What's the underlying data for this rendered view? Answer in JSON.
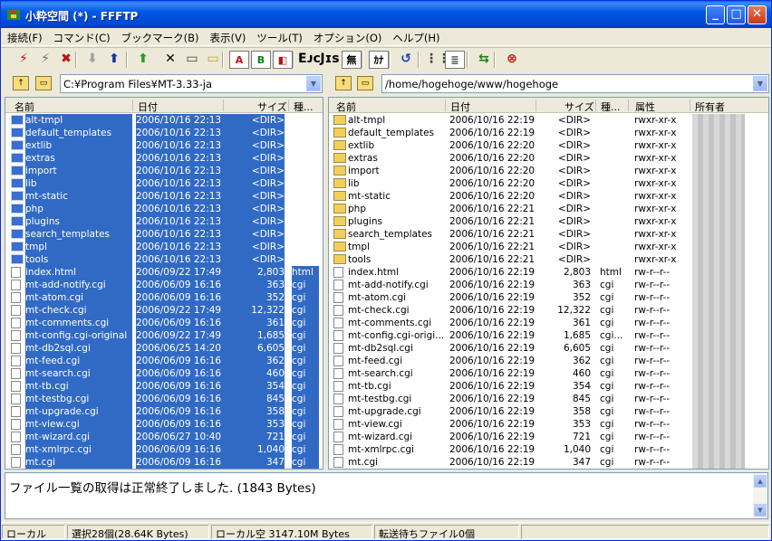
{
  "window": {
    "title": "小粋空間 (*) - FFFTP",
    "controls": {
      "minimize": "_",
      "maximize": "□",
      "close": "✕"
    }
  },
  "menu": [
    {
      "label": "接続(F)"
    },
    {
      "label": "コマンド(C)"
    },
    {
      "label": "ブックマーク(B)"
    },
    {
      "label": "表示(V)"
    },
    {
      "label": "ツール(T)"
    },
    {
      "label": "オプション(O)"
    },
    {
      "label": "ヘルプ(H)"
    }
  ],
  "toolbar": [
    {
      "name": "connect-icon",
      "glyph": "⚡",
      "color": "#d01010"
    },
    {
      "name": "quick-connect-icon",
      "glyph": "⚡",
      "color": "#707070"
    },
    {
      "name": "disconnect-icon",
      "glyph": "✖",
      "color": "#c01010"
    },
    {
      "name": "download-icon",
      "glyph": "⬇",
      "color": "#a0a0a0"
    },
    {
      "name": "upload-icon",
      "glyph": "⬆",
      "color": "#1030b0"
    },
    {
      "name": "mirror-upload-icon",
      "glyph": "⬆",
      "color": "#20a020"
    },
    {
      "name": "delete-icon",
      "glyph": "✕",
      "color": "#000000"
    },
    {
      "name": "rename-icon",
      "glyph": "▭",
      "color": "#404040"
    },
    {
      "name": "mkdir-icon",
      "glyph": "▭",
      "color": "#c8a020"
    },
    {
      "name": "ascii-mode-icon",
      "glyph": "A",
      "color": "#c01010",
      "boxed": true
    },
    {
      "name": "binary-mode-icon",
      "glyph": "B",
      "color": "#108010",
      "boxed": true
    },
    {
      "name": "auto-mode-icon",
      "glyph": "◧",
      "color": "#c01010",
      "boxed": true
    },
    {
      "name": "kanji-euc-icon",
      "glyph": "Eᴊᴄ",
      "color": "#000000"
    },
    {
      "name": "kanji-jis-icon",
      "glyph": "Jɪs",
      "color": "#000000"
    },
    {
      "name": "kanji-none-icon",
      "glyph": "無",
      "color": "#000000",
      "boxed": true
    },
    {
      "name": "kana-convert-icon",
      "glyph": "ｶﾅ",
      "color": "#000000",
      "boxed": true
    },
    {
      "name": "refresh-icon",
      "glyph": "↺",
      "color": "#1040c0"
    },
    {
      "name": "list-view-icon",
      "glyph": "⋮⋮",
      "color": "#404040"
    },
    {
      "name": "detail-view-icon",
      "glyph": "≣",
      "color": "#404040",
      "boxed": true
    },
    {
      "name": "sync-dir-icon",
      "glyph": "⇆",
      "color": "#208020"
    },
    {
      "name": "abort-icon",
      "glyph": "⊗",
      "color": "#d01010"
    }
  ],
  "local": {
    "path": "C:¥Program Files¥MT-3.33-ja",
    "headers": {
      "name": "名前",
      "date": "日付",
      "size": "サイズ",
      "type": "種..."
    },
    "rows": [
      {
        "n": "alt-tmpl",
        "d": "2006/10/16 22:13",
        "s": "<DIR>",
        "t": "",
        "dir": true
      },
      {
        "n": "default_templates",
        "d": "2006/10/16 22:13",
        "s": "<DIR>",
        "t": "",
        "dir": true
      },
      {
        "n": "extlib",
        "d": "2006/10/16 22:13",
        "s": "<DIR>",
        "t": "",
        "dir": true
      },
      {
        "n": "extras",
        "d": "2006/10/16 22:13",
        "s": "<DIR>",
        "t": "",
        "dir": true
      },
      {
        "n": "import",
        "d": "2006/10/16 22:13",
        "s": "<DIR>",
        "t": "",
        "dir": true
      },
      {
        "n": "lib",
        "d": "2006/10/16 22:13",
        "s": "<DIR>",
        "t": "",
        "dir": true
      },
      {
        "n": "mt-static",
        "d": "2006/10/16 22:13",
        "s": "<DIR>",
        "t": "",
        "dir": true
      },
      {
        "n": "php",
        "d": "2006/10/16 22:13",
        "s": "<DIR>",
        "t": "",
        "dir": true
      },
      {
        "n": "plugins",
        "d": "2006/10/16 22:13",
        "s": "<DIR>",
        "t": "",
        "dir": true
      },
      {
        "n": "search_templates",
        "d": "2006/10/16 22:13",
        "s": "<DIR>",
        "t": "",
        "dir": true
      },
      {
        "n": "tmpl",
        "d": "2006/10/16 22:13",
        "s": "<DIR>",
        "t": "",
        "dir": true
      },
      {
        "n": "tools",
        "d": "2006/10/16 22:13",
        "s": "<DIR>",
        "t": "",
        "dir": true
      },
      {
        "n": "index.html",
        "d": "2006/09/22 17:49",
        "s": "2,803",
        "t": "html",
        "dir": false
      },
      {
        "n": "mt-add-notify.cgi",
        "d": "2006/06/09 16:16",
        "s": "363",
        "t": "cgi",
        "dir": false
      },
      {
        "n": "mt-atom.cgi",
        "d": "2006/06/09 16:16",
        "s": "352",
        "t": "cgi",
        "dir": false
      },
      {
        "n": "mt-check.cgi",
        "d": "2006/09/22 17:49",
        "s": "12,322",
        "t": "cgi",
        "dir": false
      },
      {
        "n": "mt-comments.cgi",
        "d": "2006/06/09 16:16",
        "s": "361",
        "t": "cgi",
        "dir": false
      },
      {
        "n": "mt-config.cgi-original",
        "d": "2006/09/22 17:49",
        "s": "1,685",
        "t": "cgi",
        "dir": false
      },
      {
        "n": "mt-db2sql.cgi",
        "d": "2006/06/25 14:20",
        "s": "6,605",
        "t": "cgi",
        "dir": false
      },
      {
        "n": "mt-feed.cgi",
        "d": "2006/06/09 16:16",
        "s": "362",
        "t": "cgi",
        "dir": false
      },
      {
        "n": "mt-search.cgi",
        "d": "2006/06/09 16:16",
        "s": "460",
        "t": "cgi",
        "dir": false
      },
      {
        "n": "mt-tb.cgi",
        "d": "2006/06/09 16:16",
        "s": "354",
        "t": "cgi",
        "dir": false
      },
      {
        "n": "mt-testbg.cgi",
        "d": "2006/06/09 16:16",
        "s": "845",
        "t": "cgi",
        "dir": false
      },
      {
        "n": "mt-upgrade.cgi",
        "d": "2006/06/09 16:16",
        "s": "358",
        "t": "cgi",
        "dir": false
      },
      {
        "n": "mt-view.cgi",
        "d": "2006/06/09 16:16",
        "s": "353",
        "t": "cgi",
        "dir": false
      },
      {
        "n": "mt-wizard.cgi",
        "d": "2006/06/27 10:40",
        "s": "721",
        "t": "cgi",
        "dir": false
      },
      {
        "n": "mt-xmlrpc.cgi",
        "d": "2006/06/09 16:16",
        "s": "1,040",
        "t": "cgi",
        "dir": false
      },
      {
        "n": "mt.cgi",
        "d": "2006/06/09 16:16",
        "s": "347",
        "t": "cgi",
        "dir": false
      }
    ]
  },
  "remote": {
    "path": "/home/hogehoge/www/hogehoge",
    "headers": {
      "name": "名前",
      "date": "日付",
      "size": "サイズ",
      "type": "種...",
      "attr": "属性",
      "owner": "所有者"
    },
    "rows": [
      {
        "n": "alt-tmpl",
        "d": "2006/10/16 22:19",
        "s": "<DIR>",
        "t": "",
        "a": "rwxr-xr-x",
        "dir": true
      },
      {
        "n": "default_templates",
        "d": "2006/10/16 22:19",
        "s": "<DIR>",
        "t": "",
        "a": "rwxr-xr-x",
        "dir": true
      },
      {
        "n": "extlib",
        "d": "2006/10/16 22:20",
        "s": "<DIR>",
        "t": "",
        "a": "rwxr-xr-x",
        "dir": true
      },
      {
        "n": "extras",
        "d": "2006/10/16 22:20",
        "s": "<DIR>",
        "t": "",
        "a": "rwxr-xr-x",
        "dir": true
      },
      {
        "n": "import",
        "d": "2006/10/16 22:20",
        "s": "<DIR>",
        "t": "",
        "a": "rwxr-xr-x",
        "dir": true
      },
      {
        "n": "lib",
        "d": "2006/10/16 22:20",
        "s": "<DIR>",
        "t": "",
        "a": "rwxr-xr-x",
        "dir": true
      },
      {
        "n": "mt-static",
        "d": "2006/10/16 22:20",
        "s": "<DIR>",
        "t": "",
        "a": "rwxr-xr-x",
        "dir": true
      },
      {
        "n": "php",
        "d": "2006/10/16 22:21",
        "s": "<DIR>",
        "t": "",
        "a": "rwxr-xr-x",
        "dir": true
      },
      {
        "n": "plugins",
        "d": "2006/10/16 22:21",
        "s": "<DIR>",
        "t": "",
        "a": "rwxr-xr-x",
        "dir": true
      },
      {
        "n": "search_templates",
        "d": "2006/10/16 22:21",
        "s": "<DIR>",
        "t": "",
        "a": "rwxr-xr-x",
        "dir": true
      },
      {
        "n": "tmpl",
        "d": "2006/10/16 22:21",
        "s": "<DIR>",
        "t": "",
        "a": "rwxr-xr-x",
        "dir": true
      },
      {
        "n": "tools",
        "d": "2006/10/16 22:21",
        "s": "<DIR>",
        "t": "",
        "a": "rwxr-xr-x",
        "dir": true
      },
      {
        "n": "index.html",
        "d": "2006/10/16 22:19",
        "s": "2,803",
        "t": "html",
        "a": "rw-r--r--",
        "dir": false
      },
      {
        "n": "mt-add-notify.cgi",
        "d": "2006/10/16 22:19",
        "s": "363",
        "t": "cgi",
        "a": "rw-r--r--",
        "dir": false
      },
      {
        "n": "mt-atom.cgi",
        "d": "2006/10/16 22:19",
        "s": "352",
        "t": "cgi",
        "a": "rw-r--r--",
        "dir": false
      },
      {
        "n": "mt-check.cgi",
        "d": "2006/10/16 22:19",
        "s": "12,322",
        "t": "cgi",
        "a": "rw-r--r--",
        "dir": false
      },
      {
        "n": "mt-comments.cgi",
        "d": "2006/10/16 22:19",
        "s": "361",
        "t": "cgi",
        "a": "rw-r--r--",
        "dir": false
      },
      {
        "n": "mt-config.cgi-origi...",
        "d": "2006/10/16 22:19",
        "s": "1,685",
        "t": "cgi...",
        "a": "rw-r--r--",
        "dir": false
      },
      {
        "n": "mt-db2sql.cgi",
        "d": "2006/10/16 22:19",
        "s": "6,605",
        "t": "cgi",
        "a": "rw-r--r--",
        "dir": false
      },
      {
        "n": "mt-feed.cgi",
        "d": "2006/10/16 22:19",
        "s": "362",
        "t": "cgi",
        "a": "rw-r--r--",
        "dir": false
      },
      {
        "n": "mt-search.cgi",
        "d": "2006/10/16 22:19",
        "s": "460",
        "t": "cgi",
        "a": "rw-r--r--",
        "dir": false
      },
      {
        "n": "mt-tb.cgi",
        "d": "2006/10/16 22:19",
        "s": "354",
        "t": "cgi",
        "a": "rw-r--r--",
        "dir": false
      },
      {
        "n": "mt-testbg.cgi",
        "d": "2006/10/16 22:19",
        "s": "845",
        "t": "cgi",
        "a": "rw-r--r--",
        "dir": false
      },
      {
        "n": "mt-upgrade.cgi",
        "d": "2006/10/16 22:19",
        "s": "358",
        "t": "cgi",
        "a": "rw-r--r--",
        "dir": false
      },
      {
        "n": "mt-view.cgi",
        "d": "2006/10/16 22:19",
        "s": "353",
        "t": "cgi",
        "a": "rw-r--r--",
        "dir": false
      },
      {
        "n": "mt-wizard.cgi",
        "d": "2006/10/16 22:19",
        "s": "721",
        "t": "cgi",
        "a": "rw-r--r--",
        "dir": false
      },
      {
        "n": "mt-xmlrpc.cgi",
        "d": "2006/10/16 22:19",
        "s": "1,040",
        "t": "cgi",
        "a": "rw-r--r--",
        "dir": false
      },
      {
        "n": "mt.cgi",
        "d": "2006/10/16 22:19",
        "s": "347",
        "t": "cgi",
        "a": "rw-r--r--",
        "dir": false
      }
    ]
  },
  "log": {
    "message": "ファイル一覧の取得は正常終了しました. (1843 Bytes)"
  },
  "status": {
    "location": "ローカル",
    "selection": "選択28個(28.64K Bytes)",
    "local_free": "ローカル空 3147.10M Bytes",
    "queue": "転送待ちファイル0個"
  },
  "colors": {
    "selection": "#316ac5",
    "titlebar": "#0054e3"
  }
}
